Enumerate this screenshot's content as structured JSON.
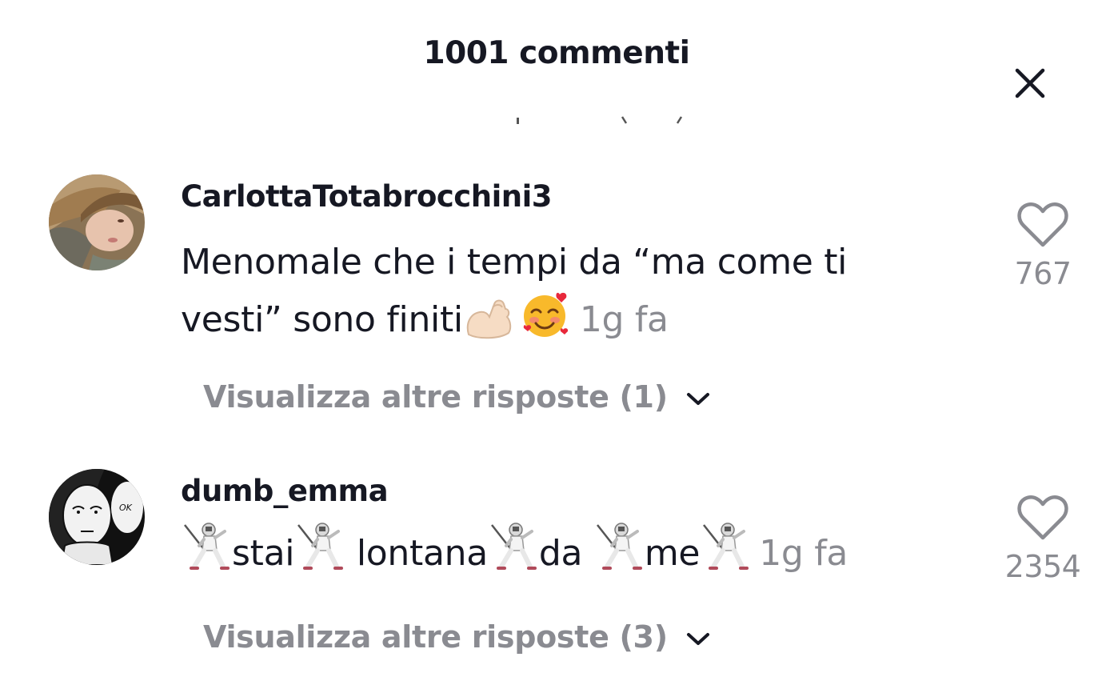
{
  "header": {
    "title": "1001 commenti",
    "close_icon": "close-icon"
  },
  "comments": [
    {
      "username": "CarlottaTotabrocchini3",
      "text_line1": "Menomale che i tempi da “ma come ti",
      "text_line2": "vesti” sono finiti",
      "emojis": [
        "flexed-biceps-emoji",
        "smiling-face-with-hearts-emoji"
      ],
      "timestamp": "1g fa",
      "likes": "767",
      "replies_label": "Visualizza altre risposte (1)"
    },
    {
      "username": "dumb_emma",
      "words": [
        "stai",
        "lontana",
        "da",
        "me"
      ],
      "emoji": "fencer-emoji",
      "timestamp": "1g fa",
      "likes": "2354",
      "replies_label": "Visualizza altre risposte (3)"
    }
  ],
  "colors": {
    "primary_text": "#161823",
    "secondary_text": "#8a8b91",
    "background": "#ffffff"
  }
}
